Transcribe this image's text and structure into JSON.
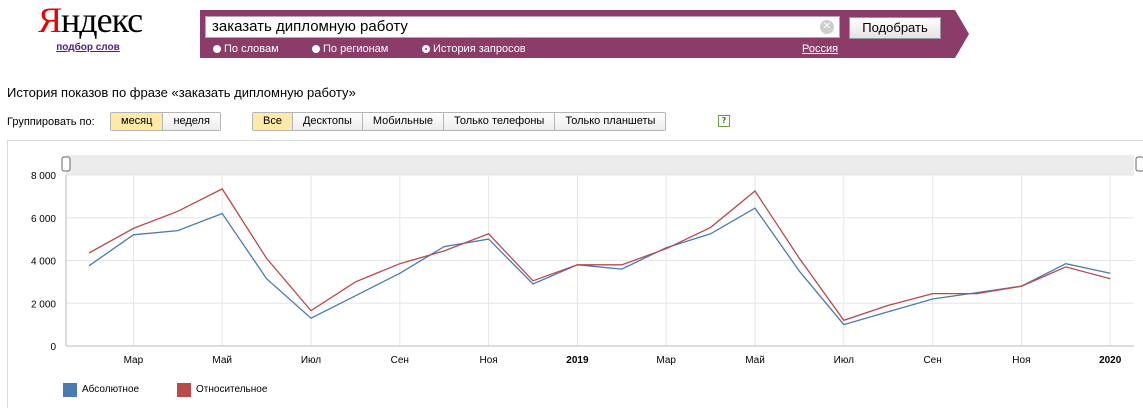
{
  "logo": {
    "text": "Яндекс",
    "sub": "подбор слов"
  },
  "search": {
    "query": "заказать дипломную работу",
    "submit_label": "Подобрать",
    "region": "Россия"
  },
  "modes": [
    {
      "label": "По словам",
      "selected": false
    },
    {
      "label": "По регионам",
      "selected": false
    },
    {
      "label": "История запросов",
      "selected": true
    }
  ],
  "page_title": "История показов по фразе «заказать дипломную работу»",
  "grouping": {
    "label": "Группировать по:",
    "options": [
      "месяц",
      "неделя"
    ],
    "active": 0
  },
  "devices": {
    "options": [
      "Все",
      "Десктопы",
      "Мобильные",
      "Только телефоны",
      "Только планшеты"
    ],
    "active": 0
  },
  "help": "?",
  "colors": {
    "absolute": "#4a7ab4",
    "relative": "#b84a4a",
    "band": "#8c3c68"
  },
  "chart_data": {
    "type": "line",
    "ylim": [
      0,
      8000
    ],
    "yticks": [
      "0",
      "2 000",
      "4 000",
      "6 000",
      "8 000"
    ],
    "xticks": [
      {
        "label": "Мар",
        "bold": false
      },
      {
        "label": "Май",
        "bold": false
      },
      {
        "label": "Июл",
        "bold": false
      },
      {
        "label": "Сен",
        "bold": false
      },
      {
        "label": "Ноя",
        "bold": false
      },
      {
        "label": "2019",
        "bold": true
      },
      {
        "label": "Мар",
        "bold": false
      },
      {
        "label": "Май",
        "bold": false
      },
      {
        "label": "Июл",
        "bold": false
      },
      {
        "label": "Сен",
        "bold": false
      },
      {
        "label": "Ноя",
        "bold": false
      },
      {
        "label": "2020",
        "bold": true
      }
    ],
    "x": [
      "2018-02",
      "2018-03",
      "2018-04",
      "2018-05",
      "2018-06",
      "2018-07",
      "2018-08",
      "2018-09",
      "2018-10",
      "2018-11",
      "2018-12",
      "2019-01",
      "2019-02",
      "2019-03",
      "2019-04",
      "2019-05",
      "2019-06",
      "2019-07",
      "2019-08",
      "2019-09",
      "2019-10",
      "2019-11",
      "2019-12",
      "2020-01"
    ],
    "series": [
      {
        "name": "Абсолютное",
        "values": [
          3750,
          5200,
          5400,
          6200,
          3150,
          1300,
          2350,
          3400,
          4650,
          5000,
          2900,
          3800,
          3600,
          4600,
          5250,
          6450,
          3500,
          1000,
          1600,
          2200,
          2500,
          2800,
          3850,
          3400
        ]
      },
      {
        "name": "Относительное",
        "values": [
          4350,
          5500,
          6300,
          7350,
          4100,
          1650,
          3000,
          3850,
          4450,
          5250,
          3050,
          3800,
          3800,
          4550,
          5550,
          7250,
          4100,
          1200,
          1900,
          2450,
          2450,
          2800,
          3700,
          3150
        ]
      }
    ]
  }
}
